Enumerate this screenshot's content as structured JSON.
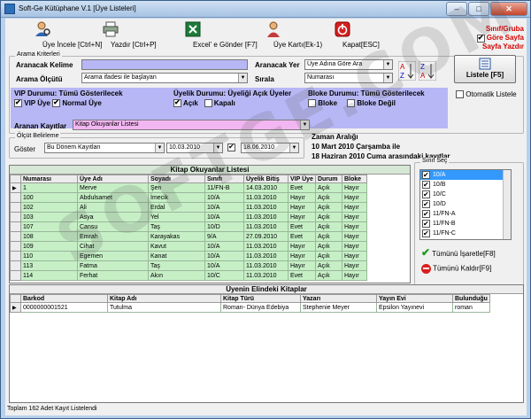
{
  "window": {
    "title": "Soft-Ge Kütüphane V.1 [Üye Listeleri]"
  },
  "toolbar": {
    "items": [
      {
        "label": "Üye İncele [Ctrl+N]",
        "icon": "person-search-icon"
      },
      {
        "label": "Yazdır [Ctrl+P]",
        "icon": "printer-icon"
      },
      {
        "label": "Excel' e Gönder [F7]",
        "icon": "excel-icon"
      },
      {
        "label": "Üye Kartı(Ek-1)",
        "icon": "member-card-icon"
      },
      {
        "label": "Kapat[ESC]",
        "icon": "power-icon"
      }
    ],
    "note": [
      "Sınıf/Gruba",
      "Göre Sayfa",
      "Sayfa Yazdır"
    ]
  },
  "search": {
    "group_title": "Arama Kriterleri",
    "keyword_label": "Aranacak Kelime",
    "keyword_value": "",
    "criterion_label": "Arama Ölçütü",
    "criterion_value": "Arama ifadesi ile başlayan",
    "place_label": "Aranacak Yer",
    "place_value": "Üye Adına Göre Ara",
    "sort_label": "Sırala",
    "sort_value": "Numarası",
    "list_button": "Listele [F5]",
    "auto_list_label": "Otomatik Listele",
    "vip_title": "VIP Durumu:",
    "vip_value": "Tümü Gösterilecek",
    "vip_opt1": "VIP Üye",
    "vip_opt2": "Normal Üye",
    "member_title": "Üyelik Durumu:",
    "member_value": "Üyeliği Açık Üyeler",
    "member_opt1": "Açık",
    "member_opt2": "Kapalı",
    "block_title": "Bloke Durumu:",
    "block_value": "Tümü Gösterilecek",
    "block_opt1": "Bloke",
    "block_opt2": "Bloke Değil",
    "target_label": "Aranan Kayıtlar",
    "target_value": "Kitap Okuyanlar Listesi"
  },
  "range": {
    "group_title": "Ölçüt Belirleme",
    "show_label": "Göster",
    "show_value": "Bu Dönem Kayıtları",
    "date_from": "10.03.2010",
    "date_to": "18.06.2010",
    "interval_title": "Zaman Aralığı",
    "interval_line1": "10 Mart 2010 Çarşamba ile",
    "interval_line2": "18 Haziran 2010 Cuma arasındaki kayıtlar"
  },
  "readers": {
    "title": "Kitap Okuyanlar Listesi",
    "columns": [
      "Numarası",
      "Üye Adı",
      "Soyadı",
      "Sınıfı",
      "Üyelik Bitiş",
      "VIP Üye",
      "Durum",
      "Bloke"
    ],
    "rows": [
      [
        "1",
        "Merve",
        "Şen",
        "11/FN-B",
        "14.03.2010",
        "Evet",
        "Açık",
        "Hayır"
      ],
      [
        "100",
        "Abdulsamet",
        "İmecik",
        "10/A",
        "11.03.2010",
        "Hayır",
        "Açık",
        "Hayır"
      ],
      [
        "102",
        "Ali",
        "Erdal",
        "10/A",
        "11.03.2010",
        "Hayır",
        "Açık",
        "Hayır"
      ],
      [
        "103",
        "Asya",
        "Yel",
        "10/A",
        "11.03.2010",
        "Hayır",
        "Açık",
        "Hayır"
      ],
      [
        "107",
        "Cansu",
        "Taş",
        "10/D",
        "11.03.2010",
        "Evet",
        "Açık",
        "Hayır"
      ],
      [
        "108",
        "Emrah",
        "Karayakas",
        "9/A",
        "27.09.2010",
        "Evet",
        "Açık",
        "Hayır"
      ],
      [
        "109",
        "Cihat",
        "Kavut",
        "10/A",
        "11.03.2010",
        "Hayır",
        "Açık",
        "Hayır"
      ],
      [
        "110",
        "Egemen",
        "Kanat",
        "10/A",
        "11.03.2010",
        "Hayır",
        "Açık",
        "Hayır"
      ],
      [
        "113",
        "Fatma",
        "Taş",
        "10/A",
        "11.03.2010",
        "Hayır",
        "Açık",
        "Hayır"
      ],
      [
        "114",
        "Ferhat",
        "Akın",
        "10/C",
        "11.03.2010",
        "Evet",
        "Açık",
        "Hayır"
      ]
    ]
  },
  "classes": {
    "group_title": "Sınıf Seç",
    "items": [
      "10/A",
      "10/B",
      "10/C",
      "10/D",
      "11/FN-A",
      "11/FN-B",
      "11/FN-C"
    ],
    "select_all": "Tümünü İşaretle[F8]",
    "clear_all": "Tümünü Kaldır[F9]"
  },
  "books": {
    "title": "Üyenin Elindeki Kitaplar",
    "columns": [
      "Barkod",
      "Kitap Adı",
      "Kitap Türü",
      "Yazarı",
      "Yayın Evi",
      "Bulunduğu"
    ],
    "rows": [
      [
        "0000000001521",
        "Tutulma",
        "Roman- Dünya Edebiya",
        "Stephenie Meyer",
        "Epsilon Yayınevi",
        "roman"
      ]
    ]
  },
  "status": {
    "text": "Toplam 162 Adet Kayıt Listelendi"
  },
  "watermark": "SOFTGE.COM",
  "colors": {
    "field_blue": "#b7b7f5",
    "field_pink": "#f2b6f2",
    "row_green": "#c6efc6",
    "note_red": "#d60000"
  }
}
